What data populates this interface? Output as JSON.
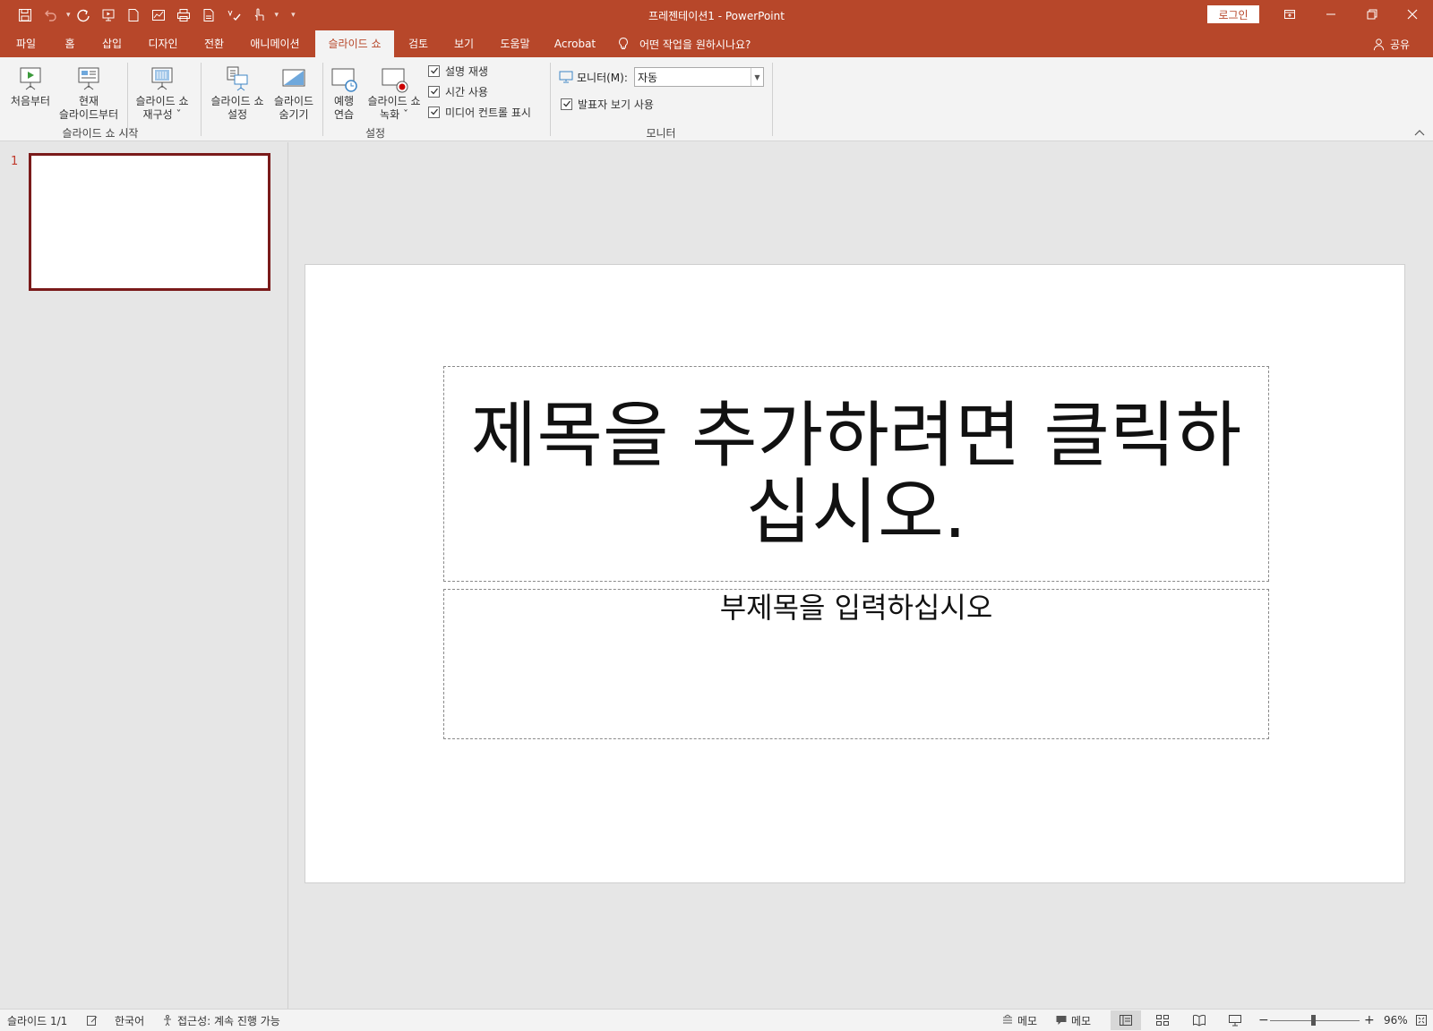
{
  "window": {
    "title": "프레젠테이션1  -  PowerPoint",
    "login_label": "로그인"
  },
  "tabs": [
    {
      "label": "파일",
      "active": false
    },
    {
      "label": "홈",
      "active": false
    },
    {
      "label": "삽입",
      "active": false
    },
    {
      "label": "디자인",
      "active": false
    },
    {
      "label": "전환",
      "active": false
    },
    {
      "label": "애니메이션",
      "active": false
    },
    {
      "label": "슬라이드 쇼",
      "active": true
    },
    {
      "label": "검토",
      "active": false
    },
    {
      "label": "보기",
      "active": false
    },
    {
      "label": "도움말",
      "active": false
    },
    {
      "label": "Acrobat",
      "active": false
    }
  ],
  "tell_me": "어떤 작업을 원하시나요?",
  "share_label": "공유",
  "ribbon": {
    "start_group": {
      "label": "슬라이드 쇼 시작",
      "from_beginning": "처음부터",
      "from_current_1": "현재",
      "from_current_2": "슬라이드부터",
      "custom_1": "슬라이드 쇼",
      "custom_2": "재구성 ˇ"
    },
    "setup_group": {
      "label": "설정",
      "setup_1": "슬라이드 쇼",
      "setup_2": "설정",
      "hide_1": "슬라이드",
      "hide_2": "숨기기",
      "rehearse_1": "예행",
      "rehearse_2": "연습",
      "record_1": "슬라이드 쇼",
      "record_2": "녹화 ˇ",
      "play_narrations": "설명 재생",
      "use_timings": "시간 사용",
      "show_media_controls": "미디어 컨트롤 표시"
    },
    "monitor_group": {
      "label": "모니터",
      "monitor_label": "모니터(M):",
      "monitor_value": "자동",
      "presenter_view": "발표자 보기 사용"
    }
  },
  "thumbnails": [
    {
      "number": "1"
    }
  ],
  "slide": {
    "title_placeholder": "제목을 추가하려면 클릭하십시오.",
    "subtitle_placeholder": "부제목을 입력하십시오"
  },
  "status": {
    "slide_info": "슬라이드 1/1",
    "language": "한국어",
    "accessibility": "접근성: 계속 진행 가능",
    "notes_label": "메모",
    "comments_label": "메모",
    "zoom": "96%"
  },
  "colors": {
    "accent": "#b7472a",
    "ribbon_bg": "#f3f3f3",
    "thumb_border": "#7a1a1a"
  }
}
